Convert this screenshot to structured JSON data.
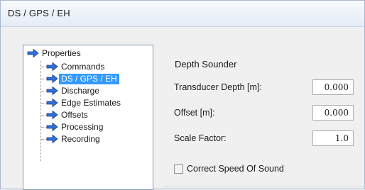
{
  "window": {
    "title": "DS / GPS / EH"
  },
  "tree": {
    "root": {
      "label": "Properties",
      "icon": "blue-arrow-icon"
    },
    "items": [
      {
        "label": "Commands",
        "icon": "blue-arrow-icon",
        "selected": false
      },
      {
        "label": "DS / GPS / EH",
        "icon": "blue-arrow-icon",
        "selected": true
      },
      {
        "label": "Discharge",
        "icon": "blue-arrow-icon",
        "selected": false
      },
      {
        "label": "Edge Estimates",
        "icon": "blue-arrow-icon",
        "selected": false
      },
      {
        "label": "Offsets",
        "icon": "blue-arrow-icon",
        "selected": false
      },
      {
        "label": "Processing",
        "icon": "blue-arrow-icon",
        "selected": false
      },
      {
        "label": "Recording",
        "icon": "blue-arrow-icon",
        "selected": false
      }
    ]
  },
  "panel": {
    "section_title": "Depth Sounder",
    "fields": [
      {
        "label": "Transducer Depth [m]:",
        "value": "0.000"
      },
      {
        "label": "Offset [m]:",
        "value": "0.000"
      },
      {
        "label": "Scale Factor:",
        "value": "1.0"
      }
    ],
    "checkbox": {
      "label": "Correct Speed Of Sound",
      "checked": false
    }
  },
  "colors": {
    "selection": "#3399ff",
    "arrow_fill": "#2f6fd6",
    "tree_border": "#7f9db9"
  }
}
